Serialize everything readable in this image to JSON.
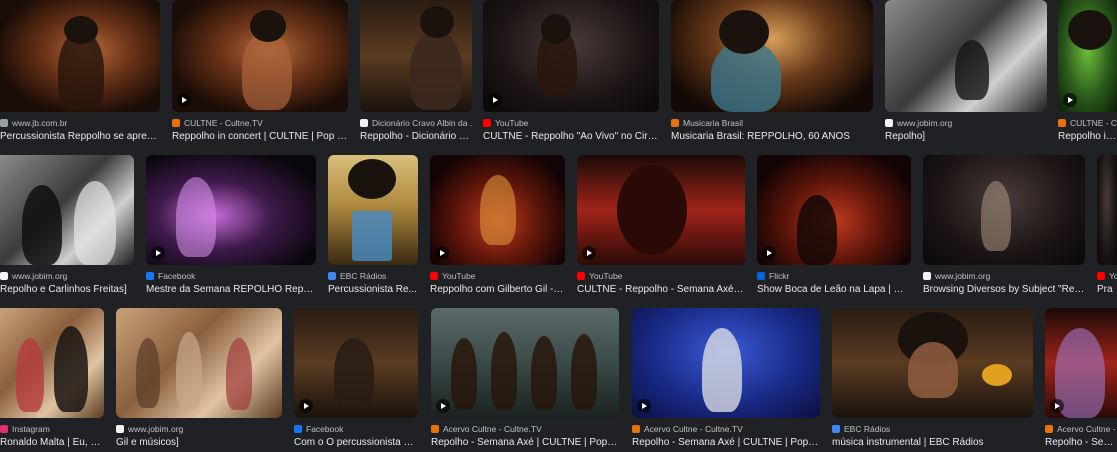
{
  "results": [
    {
      "source": "www.jb.com.br",
      "title": "Percussionista Reppolho se apresen...",
      "fav": "#9aa0a6",
      "fill": "stage-warm",
      "play": false
    },
    {
      "source": "CULTNE - Cultne.TV",
      "title": "Reppolho in concert | CULTNE | Pop & ...",
      "fav": "#e8710a",
      "fill": "stage-warm",
      "play": true
    },
    {
      "source": "Dicionário Cravo Albin da ...",
      "title": "Reppolho - Dicionário C...",
      "fav": "#f1f3f4",
      "fill": "studio",
      "play": false
    },
    {
      "source": "YouTube",
      "title": "CULTNE - Reppolho \"Ao Vivo\" no Circo ...",
      "fav": "#ff0000",
      "fill": "dark",
      "play": true
    },
    {
      "source": "Musicaria Brasil",
      "title": "Musicaria Brasil: REPPOLHO, 60 ANOS",
      "fav": "#e8710a",
      "fill": "concert",
      "play": false
    },
    {
      "source": "www.jobim.org",
      "title": "Repolho]",
      "fav": "#f1f3f4",
      "fill": "bw",
      "play": false
    },
    {
      "source": "CULTNE - C",
      "title": "Reppolho in co",
      "fav": "#e8710a",
      "fill": "green",
      "play": true
    },
    {
      "source": "www.jobim.org",
      "title": "Repolho e Carlinhos Freitas]",
      "fav": "#f1f3f4",
      "fill": "bw",
      "play": false
    },
    {
      "source": "Facebook",
      "title": "Mestre da Semana REPOLHO Reppol...",
      "fav": "#1877f2",
      "fill": "purple",
      "play": true
    },
    {
      "source": "EBC Rádios",
      "title": "Percussionista Re...",
      "fav": "#4285f4",
      "fill": "yellow",
      "play": false
    },
    {
      "source": "YouTube",
      "title": "Reppolho com Gilberto Gil - to...",
      "fav": "#ff0000",
      "fill": "stage-red",
      "play": true
    },
    {
      "source": "YouTube",
      "title": "CULTNE - Reppolho - Semana Axé - Y...",
      "fav": "#ff0000",
      "fill": "red-band",
      "play": true
    },
    {
      "source": "Flickr",
      "title": "Show Boca de Leão na Lapa | O G...",
      "fav": "#0063dc",
      "fill": "stage-red",
      "play": true
    },
    {
      "source": "www.jobim.org",
      "title": "Browsing Diversos by Subject \"Repol...",
      "fav": "#f1f3f4",
      "fill": "dark",
      "play": false
    },
    {
      "source": "Yo",
      "title": "Pra",
      "fav": "#ff0000",
      "fill": "dark",
      "play": false
    },
    {
      "source": "Instagram",
      "title": "Ronaldo Malta | Eu, R...",
      "fav": "#e1306c",
      "fill": "sepia",
      "play": false
    },
    {
      "source": "www.jobim.org",
      "title": "Gil e músicos]",
      "fav": "#f1f3f4",
      "fill": "sepia",
      "play": false
    },
    {
      "source": "Facebook",
      "title": "Com o O percussionista Re...",
      "fav": "#1877f2",
      "fill": "studio",
      "play": true
    },
    {
      "source": "Acervo Cultne - Cultne.TV",
      "title": "Repolho - Semana Axé | CULTNE | Pop & M...",
      "fav": "#e8710a",
      "fill": "teal",
      "play": true
    },
    {
      "source": "Acervo Cultne - Cultne.TV",
      "title": "Repolho - Semana Axé | CULTNE | Pop & M...",
      "fav": "#e8710a",
      "fill": "blue",
      "play": true
    },
    {
      "source": "EBC Rádios",
      "title": "música instrumental | EBC Rádios",
      "fav": "#4285f4",
      "fill": "studio",
      "play": false
    },
    {
      "source": "Acervo Cultne - C",
      "title": "Repolho - Semana",
      "fav": "#e8710a",
      "fill": "red-band",
      "play": true
    }
  ]
}
